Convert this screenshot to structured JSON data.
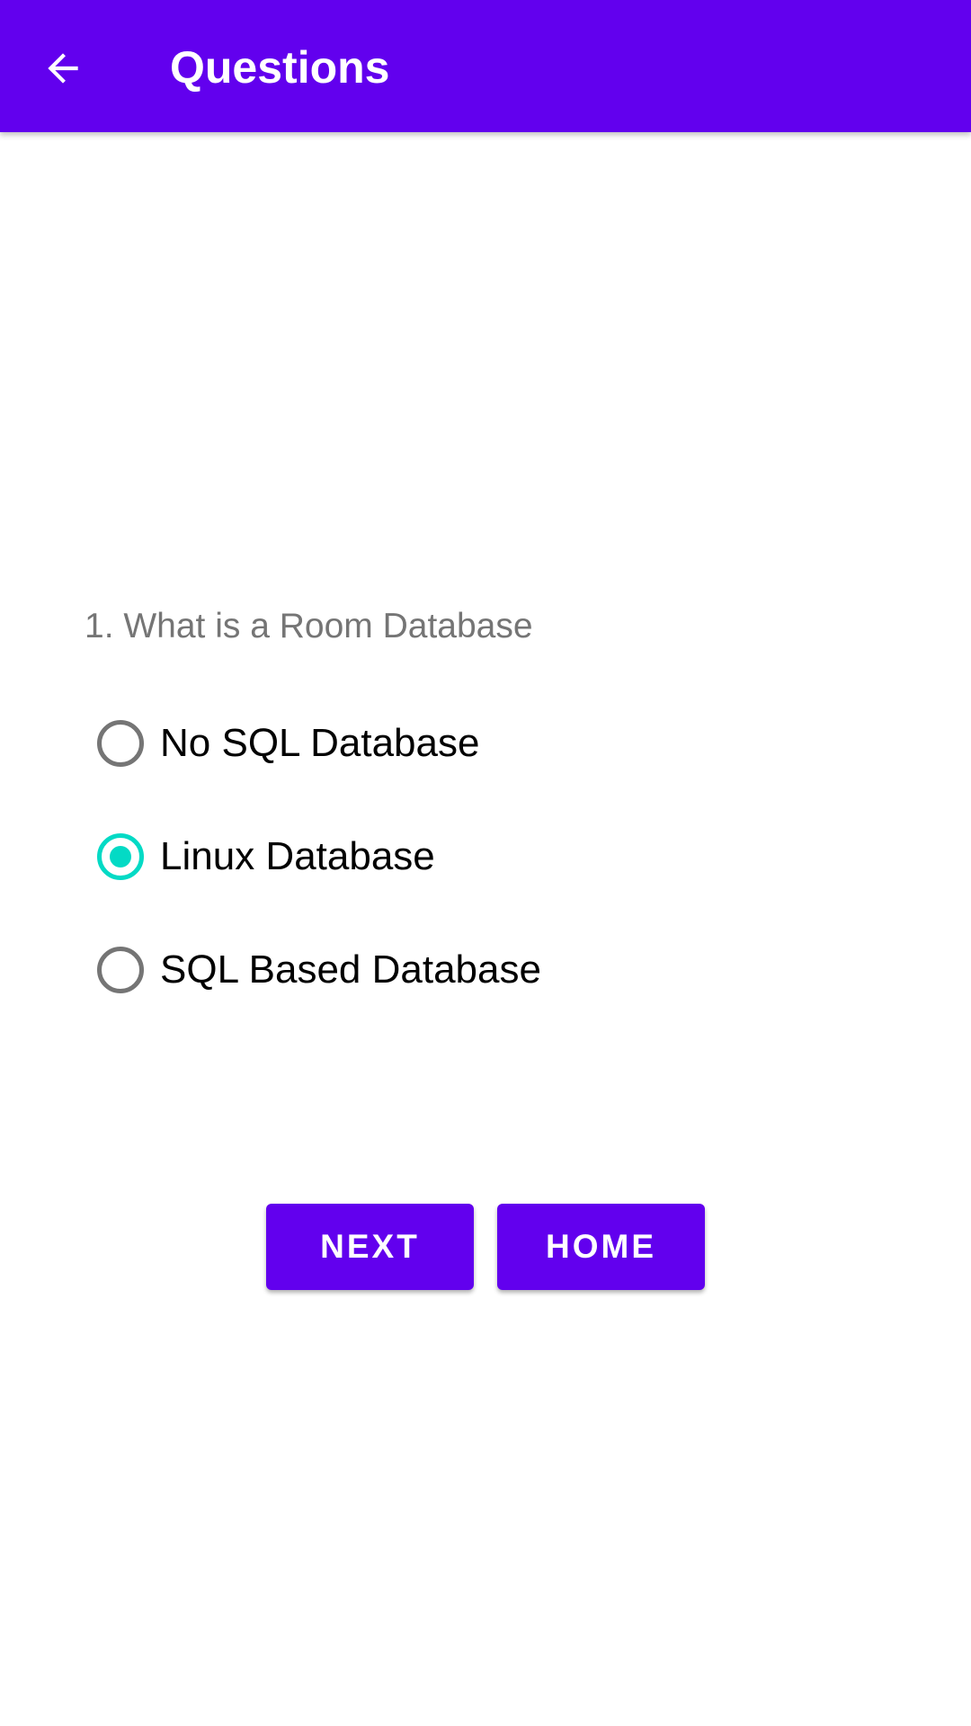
{
  "app_bar": {
    "title": "Questions",
    "back_icon": "arrow-left-icon",
    "color": "#6200EE"
  },
  "quiz": {
    "question": "1. What is a Room Database",
    "options": [
      {
        "label": "No SQL Database",
        "checked": false
      },
      {
        "label": "Linux Database",
        "checked": true
      },
      {
        "label": "SQL Based Database",
        "checked": false
      }
    ],
    "accent_color": "#03DAC5"
  },
  "actions": {
    "next_label": "NEXT",
    "home_label": "HOME"
  }
}
